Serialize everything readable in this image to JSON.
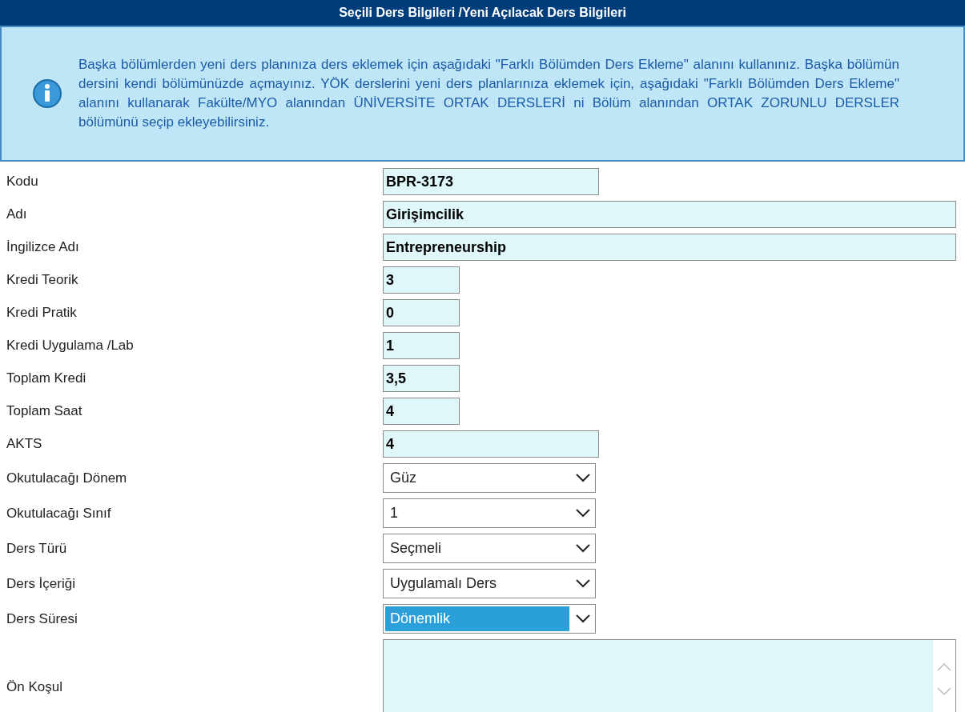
{
  "header": {
    "title": "Seçili Ders Bilgileri /Yeni Açılacak Ders Bilgileri"
  },
  "info": {
    "text": "Başka bölümlerden yeni ders planınıza ders eklemek için aşağıdaki \"Farklı Bölümden Ders Ekleme\" alanını kullanınız. Başka bölümün dersini kendi bölümünüzde açmayınız. YÖK derslerini yeni ders planlarınıza eklemek için, aşağıdaki \"Farklı Bölümden Ders Ekleme\" alanını kullanarak Fakülte/MYO alanından ÜNİVERSİTE ORTAK DERSLERİ ni Bölüm alanından ORTAK ZORUNLU DERSLER bölümünü seçip ekleyebilirsiniz."
  },
  "fields": [
    {
      "label": "Kodu",
      "kind": "text",
      "value": "BPR-3173"
    },
    {
      "label": "Adı",
      "kind": "text",
      "value": "Girişimcilik"
    },
    {
      "label": "İngilizce Adı",
      "kind": "text",
      "value": "Entrepreneurship"
    },
    {
      "label": "Kredi Teorik",
      "kind": "text",
      "value": "3"
    },
    {
      "label": "Kredi Pratik",
      "kind": "text",
      "value": "0"
    },
    {
      "label": "Kredi Uygulama /Lab",
      "kind": "text",
      "value": "1"
    },
    {
      "label": "Toplam Kredi",
      "kind": "text",
      "value": "3,5"
    },
    {
      "label": "Toplam Saat",
      "kind": "text",
      "value": "4"
    },
    {
      "label": "AKTS",
      "kind": "text",
      "value": "4"
    },
    {
      "label": "Okutulacağı Dönem",
      "kind": "select",
      "value": "Güz",
      "focused": false
    },
    {
      "label": "Okutulacağı Sınıf",
      "kind": "select",
      "value": "1",
      "focused": false
    },
    {
      "label": "Ders Türü",
      "kind": "select",
      "value": "Seçmeli",
      "focused": false
    },
    {
      "label": "Ders İçeriği",
      "kind": "select",
      "value": "Uygulamalı Ders",
      "focused": false
    },
    {
      "label": "Ders Süresi",
      "kind": "select",
      "value": "Dönemlik",
      "focused": true
    },
    {
      "label": "Ön Koşul",
      "kind": "textarea"
    }
  ]
}
